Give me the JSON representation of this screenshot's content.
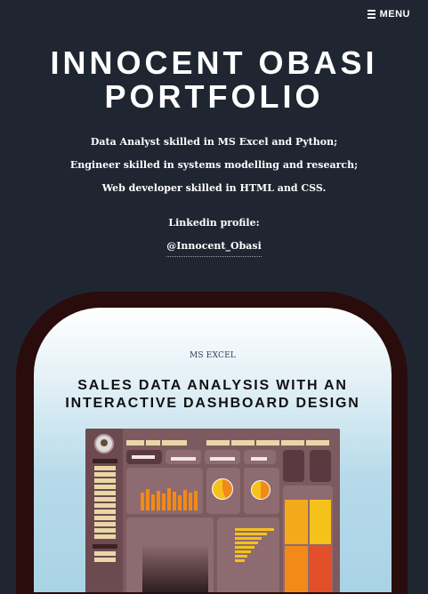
{
  "nav": {
    "menu_label": "MENU",
    "menu_icon": "hamburger-icon"
  },
  "hero": {
    "title_line1": "INNOCENT OBASI",
    "title_line2": "PORTFOLIO",
    "bio": [
      "Data Analyst skilled in MS Excel and Python;",
      "Engineer skilled in systems modelling and research;",
      "Web developer skilled in HTML and CSS."
    ],
    "linkedin_label": "Linkedin profile:",
    "linkedin_handle": "@Innocent_Obasi"
  },
  "project": {
    "category": "MS EXCEL",
    "title_line1": "SALES DATA ANALYSIS WITH AN",
    "title_line2": "INTERACTIVE DASHBOARD DESIGN",
    "thumbnail": "excel-sales-dashboard-screenshot"
  },
  "colors": {
    "background": "#1f2631",
    "frame": "#2a0c0c",
    "dashboard_bg": "#7d5a5f",
    "accent_orange": "#f28a1a",
    "accent_yellow": "#f4c21a"
  }
}
